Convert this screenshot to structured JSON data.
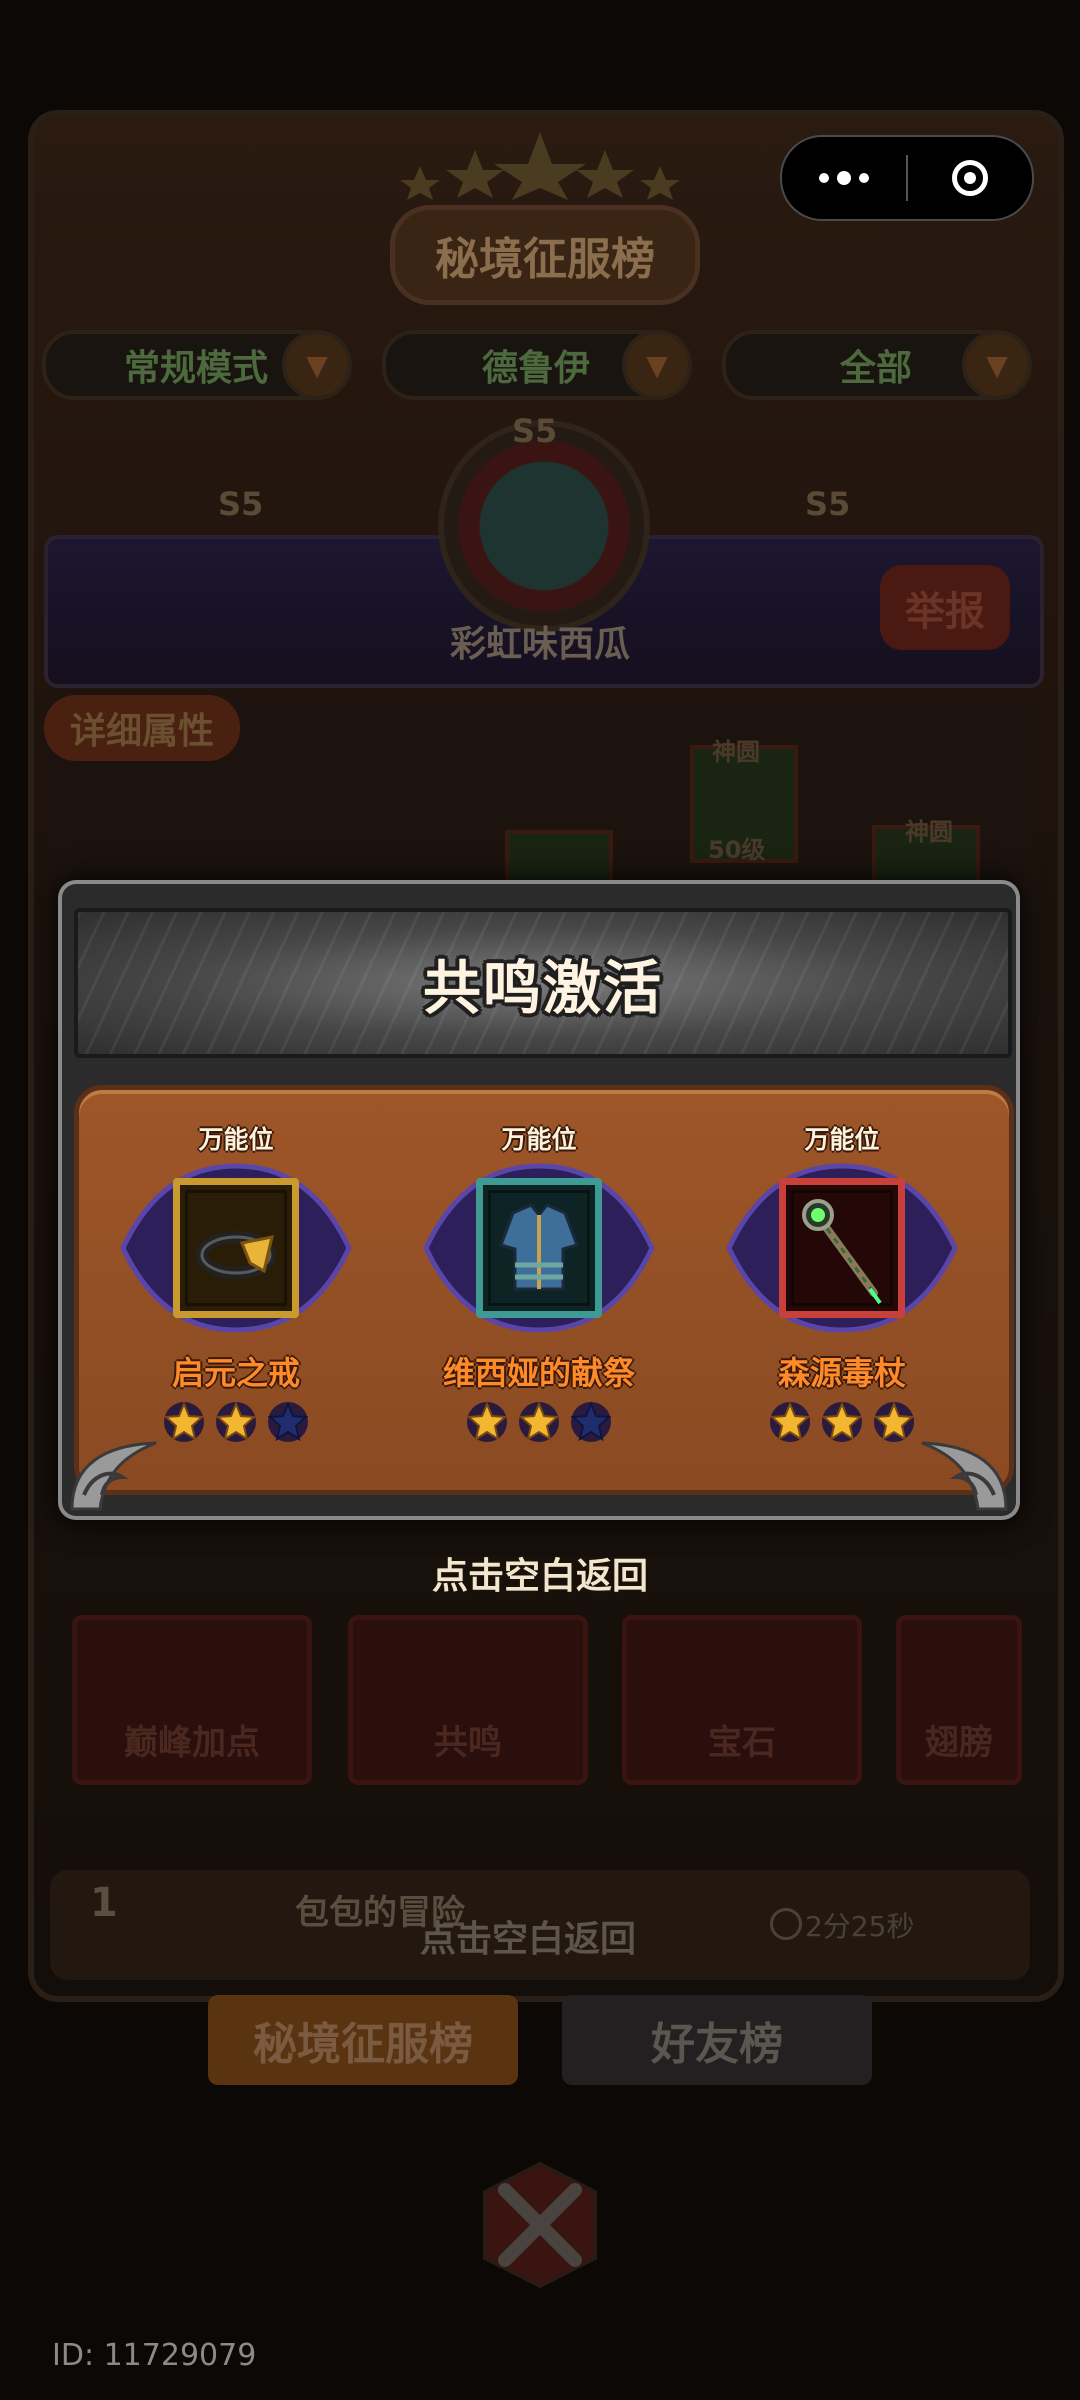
{
  "background": {
    "board_title": "秘境征服榜",
    "filters": [
      "常规模式",
      "德鲁伊",
      "全部"
    ],
    "season_badges": [
      "S5",
      "S5",
      "S5"
    ],
    "player_name": "彩虹味西瓜",
    "report_label": "举报",
    "details_tag": "详细属性",
    "equip_labels": [
      "神圆",
      "神圆"
    ],
    "equip_level": "50级",
    "feature_buttons": [
      "巅峰加点",
      "共鸣",
      "宝石",
      "翅膀"
    ],
    "rank_entry": {
      "rank": "1",
      "name": "包包的冒险",
      "time": "2分25秒"
    },
    "back_hint_behind": "点击空白返回",
    "tabs": {
      "active": "秘境征服榜",
      "inactive": "好友榜"
    }
  },
  "capsule": {
    "more_icon": "more-dots-icon",
    "close_icon": "target-ring-icon"
  },
  "modal": {
    "title": "共鸣激活",
    "items": [
      {
        "tag": "万能位",
        "name": "启元之戒",
        "icon": "ring-icon",
        "frame_color": "#c99a2e",
        "filled_stars": 2,
        "total_stars": 3
      },
      {
        "tag": "万能位",
        "name": "维西娅的献祭",
        "icon": "armor-icon",
        "frame_color": "#3f9a94",
        "filled_stars": 2,
        "total_stars": 3
      },
      {
        "tag": "万能位",
        "name": "森源毒杖",
        "icon": "staff-icon",
        "frame_color": "#c9403a",
        "filled_stars": 3,
        "total_stars": 3
      }
    ]
  },
  "back_hint": "点击空白返回",
  "footer": {
    "id_text": "ID: 11729079"
  },
  "colors": {
    "star_filled": "#f2b630",
    "star_empty": "#1f2c6e",
    "item_name": "#ff8a2a"
  }
}
